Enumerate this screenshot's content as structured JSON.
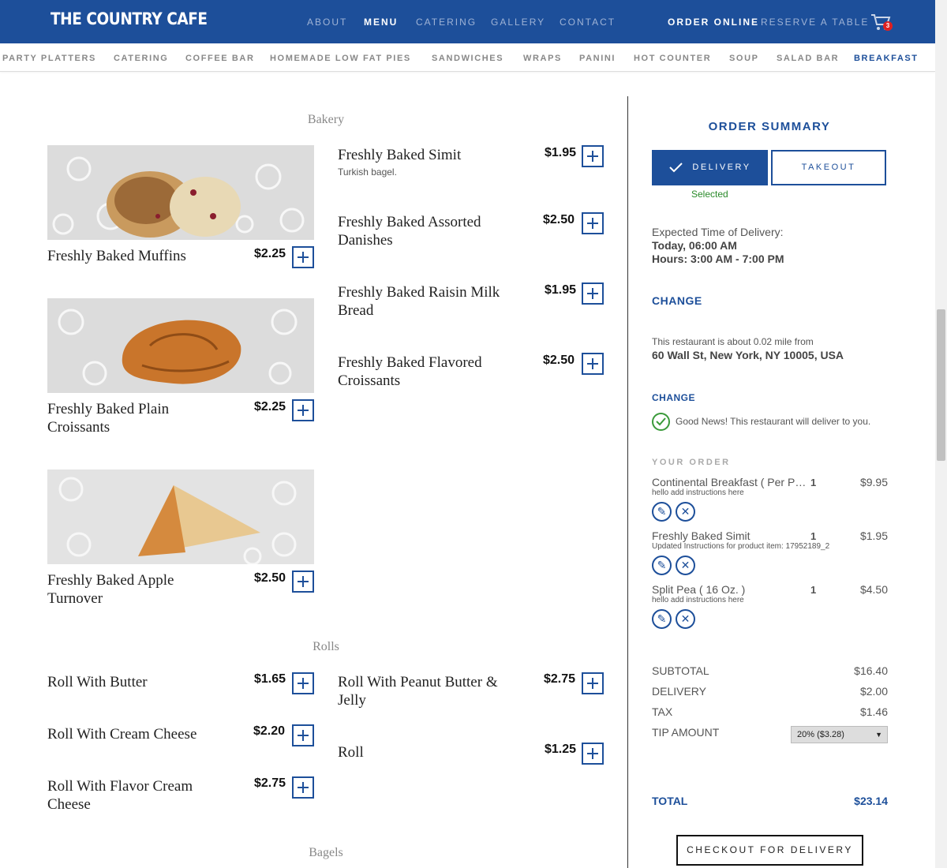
{
  "header": {
    "logo": "The Country Cafe",
    "nav": [
      "ABOUT",
      "MENU",
      "CATERING",
      "GALLERY",
      "CONTACT"
    ],
    "order_online": "ORDER ONLINE",
    "reserve": "RESERVE A TABLE",
    "cart_count": "3"
  },
  "subnav": [
    "PARTY PLATTERS",
    "CATERING",
    "COFFEE BAR",
    "HOMEMADE LOW FAT PIES",
    "SANDWICHES",
    "WRAPS",
    "PANINI",
    "HOT COUNTER",
    "SOUP",
    "SALAD BAR",
    "BREAKFAST"
  ],
  "menu": {
    "bakery_title": "Bakery",
    "bakery_left": [
      {
        "name": "Freshly Baked Muffins",
        "price": "$2.25"
      },
      {
        "name": "Freshly Baked Plain Croissants",
        "price": "$2.25"
      },
      {
        "name": "Freshly Baked Apple Turnover",
        "price": "$2.50"
      }
    ],
    "bakery_right": [
      {
        "name": "Freshly Baked Simit",
        "price": "$1.95",
        "desc": "Turkish bagel."
      },
      {
        "name": "Freshly Baked Assorted Danishes",
        "price": "$2.50"
      },
      {
        "name": "Freshly Baked Raisin Milk Bread",
        "price": "$1.95"
      },
      {
        "name": "Freshly Baked Flavored Croissants",
        "price": "$2.50"
      }
    ],
    "rolls_title": "Rolls",
    "rolls_left": [
      {
        "name": "Roll With Butter",
        "price": "$1.65"
      },
      {
        "name": "Roll With Cream Cheese",
        "price": "$2.20"
      },
      {
        "name": "Roll With Flavor Cream Cheese",
        "price": "$2.75"
      }
    ],
    "rolls_right": [
      {
        "name": "Roll With Peanut Butter & Jelly",
        "price": "$2.75"
      },
      {
        "name": "Roll",
        "price": "$1.25"
      }
    ],
    "bagels_title": "Bagels"
  },
  "summary": {
    "title": "ORDER SUMMARY",
    "delivery": "DELIVERY",
    "takeout": "TAKEOUT",
    "selected": "Selected",
    "expected_label": "Expected Time of Delivery:",
    "expected_time": "Today, 06:00 AM",
    "hours": "Hours: 3:00 AM - 7:00 PM",
    "change": "CHANGE",
    "distance_text": "This restaurant is about 0.02 mile from",
    "address": "60 Wall St, New York, NY 10005, USA",
    "good_news": "Good News! This restaurant will deliver to you.",
    "your_order": "YOUR ORDER",
    "items": [
      {
        "name": "Continental Breakfast ( Per Person )",
        "qty": "1",
        "price": "$9.95",
        "note": "hello add instructions here"
      },
      {
        "name": "Freshly Baked Simit",
        "qty": "1",
        "price": "$1.95",
        "note": "Updated Instructions for product item: 17952189_2"
      },
      {
        "name": "Split Pea ( 16 Oz. )",
        "qty": "1",
        "price": "$4.50",
        "note": "hello add instructions here"
      }
    ],
    "subtotal_label": "SUBTOTAL",
    "subtotal": "$16.40",
    "delivery_label": "DELIVERY",
    "delivery_fee": "$2.00",
    "tax_label": "TAX",
    "tax": "$1.46",
    "tip_label": "TIP AMOUNT",
    "tip": "20% ($3.28)",
    "total_label": "TOTAL",
    "total": "$23.14",
    "checkout": "CHECKOUT FOR DELIVERY"
  },
  "colors": {
    "brand": "#1d4f9a",
    "success": "#3a9a3a",
    "badge": "#e02020"
  }
}
